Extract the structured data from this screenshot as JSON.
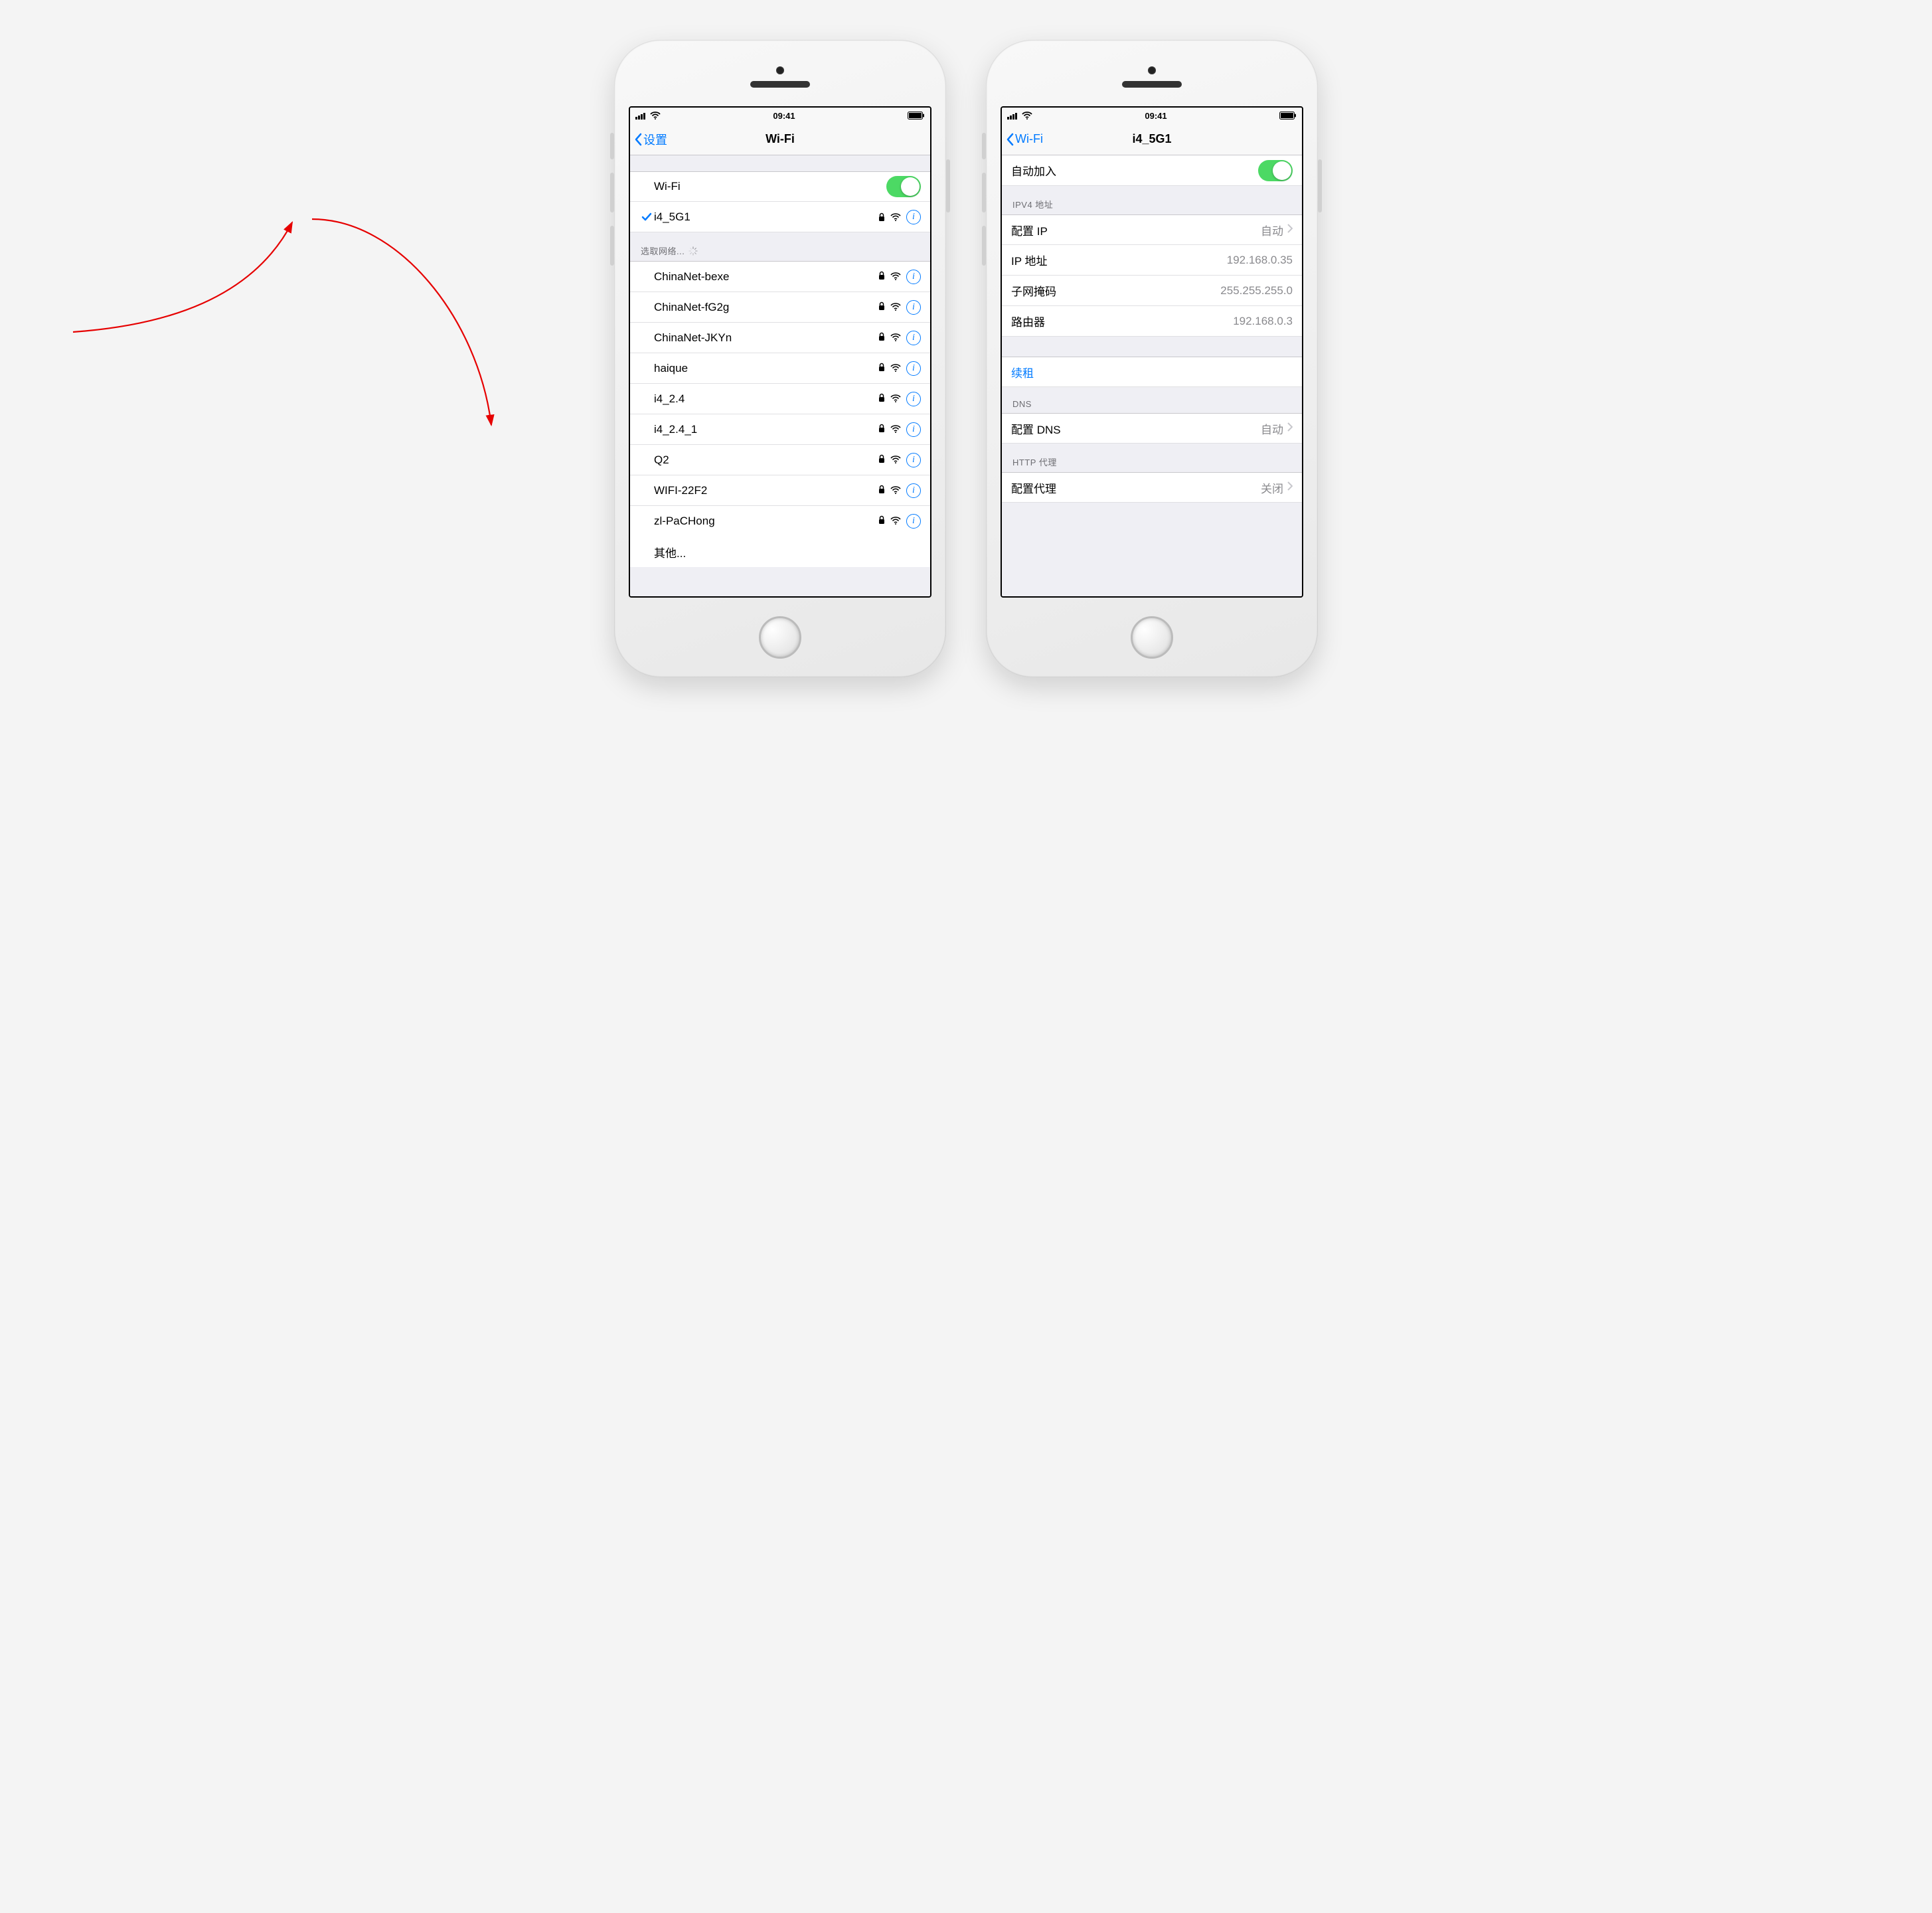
{
  "status": {
    "time": "09:41"
  },
  "left_screen": {
    "back_label": "设置",
    "title": "Wi-Fi",
    "wifi_row_label": "Wi-Fi",
    "connected_ssid": "i4_5G1",
    "networks_header": "选取网络...",
    "other_label": "其他...",
    "networks": [
      {
        "ssid": "ChinaNet-bexe"
      },
      {
        "ssid": "ChinaNet-fG2g"
      },
      {
        "ssid": "ChinaNet-JKYn"
      },
      {
        "ssid": "haique"
      },
      {
        "ssid": "i4_2.4"
      },
      {
        "ssid": "i4_2.4_1"
      },
      {
        "ssid": "Q2"
      },
      {
        "ssid": "WIFI-22F2"
      },
      {
        "ssid": "zl-PaCHong"
      }
    ]
  },
  "right_screen": {
    "back_label": "Wi-Fi",
    "title": "i4_5G1",
    "auto_join_label": "自动加入",
    "ipv4_header": "IPV4 地址",
    "configure_ip_label": "配置 IP",
    "configure_ip_value": "自动",
    "ip_addr_label": "IP 地址",
    "ip_addr_value": "192.168.0.35",
    "subnet_label": "子网掩码",
    "subnet_value": "255.255.255.0",
    "router_label": "路由器",
    "router_value": "192.168.0.3",
    "renew_label": "续租",
    "dns_header": "DNS",
    "configure_dns_label": "配置 DNS",
    "configure_dns_value": "自动",
    "proxy_header": "HTTP 代理",
    "configure_proxy_label": "配置代理",
    "configure_proxy_value": "关闭"
  }
}
